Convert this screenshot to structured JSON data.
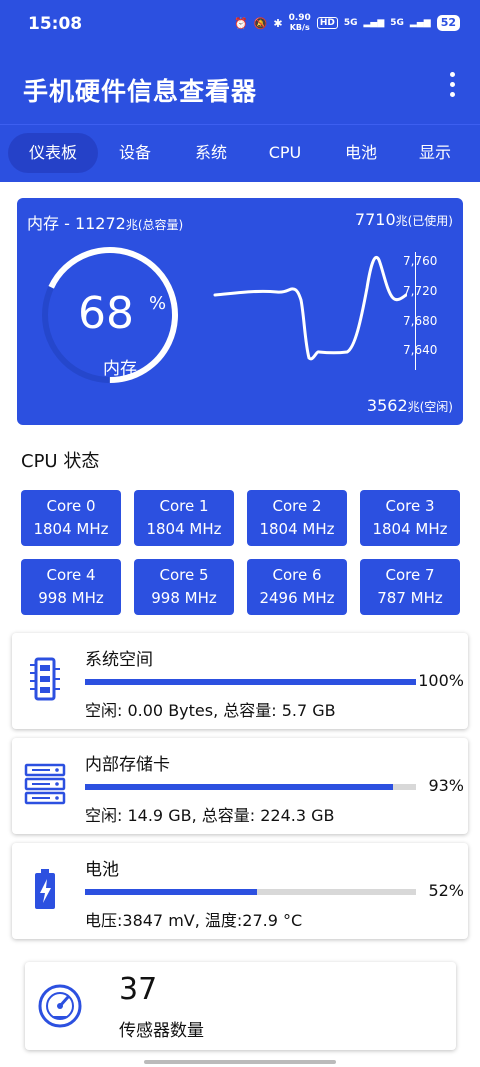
{
  "status": {
    "time": "15:08",
    "net_speed_value": "0.90",
    "net_speed_unit": "KB/s",
    "hd": "HD",
    "sig1": "5G",
    "sig2": "5G",
    "battery": "52"
  },
  "app": {
    "title": "手机硬件信息查看器",
    "menu_icon": "more-vert-icon"
  },
  "tabs": [
    "仪表板",
    "设备",
    "系统",
    "CPU",
    "电池",
    "显示"
  ],
  "memory": {
    "total_prefix": "内存 - 11272",
    "total_suffix": "兆(总容量)",
    "used_value": "7710",
    "used_suffix": "兆(已使用)",
    "free_value": "3562",
    "free_suffix": "兆(空闲)",
    "percent": "68",
    "percent_sign": "%",
    "gauge_fraction": 0.68,
    "label": "内存",
    "chart_ticks": [
      "7,760",
      "7,720",
      "7,680",
      "7,640"
    ]
  },
  "cpu": {
    "title": "CPU 状态",
    "cores": [
      {
        "name": "Core 0",
        "freq": "1804 MHz"
      },
      {
        "name": "Core 1",
        "freq": "1804 MHz"
      },
      {
        "name": "Core 2",
        "freq": "1804 MHz"
      },
      {
        "name": "Core 3",
        "freq": "1804 MHz"
      },
      {
        "name": "Core 4",
        "freq": "998 MHz"
      },
      {
        "name": "Core 5",
        "freq": "998 MHz"
      },
      {
        "name": "Core 6",
        "freq": "2496 MHz"
      },
      {
        "name": "Core 7",
        "freq": "787 MHz"
      }
    ]
  },
  "storage": [
    {
      "title": "系统空间",
      "percent": "100%",
      "fraction": 1.0,
      "detail": "空闲: 0.00 Bytes, 总容量: 5.7 GB",
      "icon": "ram-chip-icon"
    },
    {
      "title": "内部存储卡",
      "percent": "93%",
      "fraction": 0.93,
      "detail": "空闲: 14.9 GB, 总容量: 224.3 GB",
      "icon": "server-storage-icon"
    },
    {
      "title": "电池",
      "percent": "52%",
      "fraction": 0.52,
      "detail": "电压:3847 mV, 温度:27.9 °C",
      "icon": "battery-charging-icon"
    }
  ],
  "sensors": {
    "count": "37",
    "label": "传感器数量",
    "icon": "speedometer-icon"
  },
  "colors": {
    "primary": "#2c50e0",
    "tab_active": "#2541c8",
    "track": "#d8d8d8"
  }
}
